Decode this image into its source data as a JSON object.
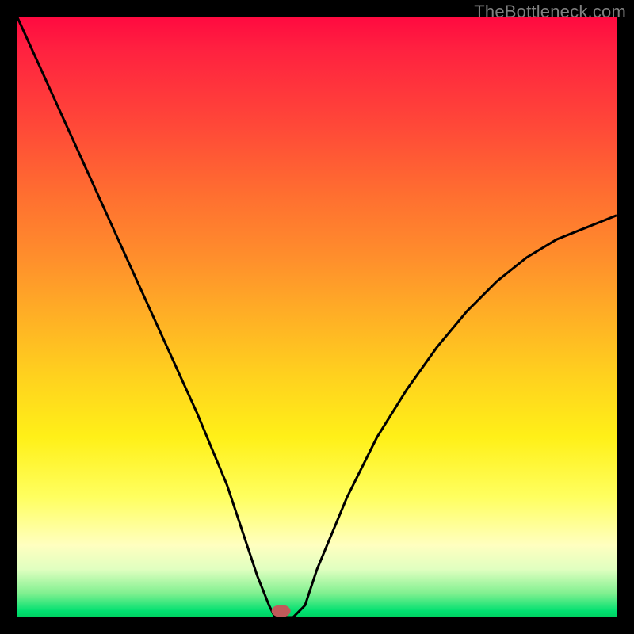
{
  "watermark": "TheBottleneck.com",
  "chart_data": {
    "type": "line",
    "title": "",
    "xlabel": "",
    "ylabel": "",
    "xlim": [
      0,
      100
    ],
    "ylim": [
      0,
      100
    ],
    "grid": false,
    "x": [
      0,
      5,
      10,
      15,
      20,
      25,
      30,
      35,
      38,
      40,
      42,
      43,
      44,
      45,
      46,
      48,
      50,
      55,
      60,
      65,
      70,
      75,
      80,
      85,
      90,
      95,
      100
    ],
    "values": [
      100,
      89,
      78,
      67,
      56,
      45,
      34,
      22,
      13,
      7,
      2,
      0,
      0,
      0,
      0,
      2,
      8,
      20,
      30,
      38,
      45,
      51,
      56,
      60,
      63,
      65,
      67
    ],
    "minimum_x": 44,
    "minimum_value": 0,
    "marker_color": "#c05a5a",
    "gradient_colors": {
      "top": "#ff0a40",
      "bottom": "#00d060"
    }
  }
}
